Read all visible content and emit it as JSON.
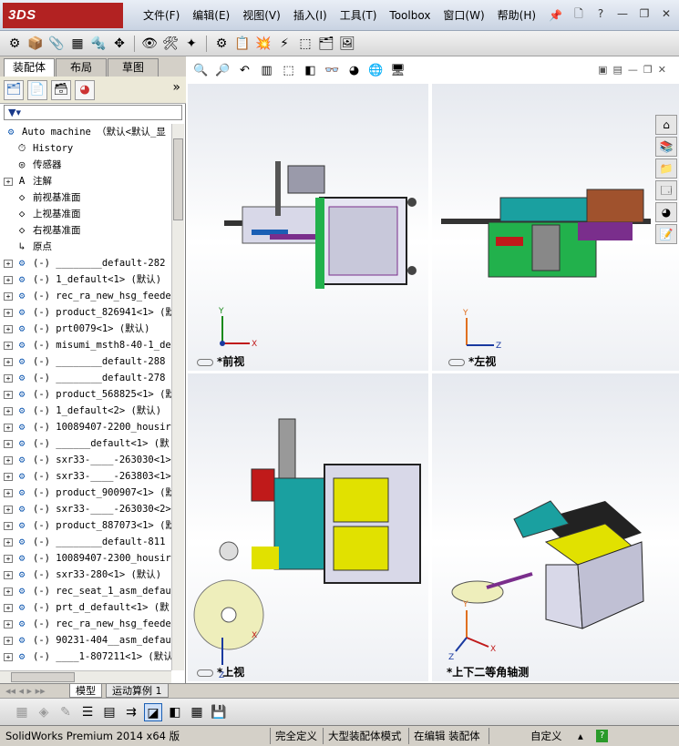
{
  "app": {
    "logo": "3DS SOLIDWORKS"
  },
  "menu": [
    "文件(F)",
    "编辑(E)",
    "视图(V)",
    "插入(I)",
    "工具(T)",
    "Toolbox",
    "窗口(W)",
    "帮助(H)"
  ],
  "panel": {
    "tabs": [
      "装配体",
      "布局",
      "草图"
    ],
    "filter_icon": "filter-icon"
  },
  "tree": {
    "root": "Auto machine （默认<默认_显",
    "items": [
      {
        "icon": "history",
        "label": "History",
        "expand": false
      },
      {
        "icon": "sensor",
        "label": "传感器",
        "expand": false
      },
      {
        "icon": "annotation",
        "label": "注解",
        "expand": true
      },
      {
        "icon": "plane",
        "label": "前视基准面",
        "expand": false
      },
      {
        "icon": "plane",
        "label": "上视基准面",
        "expand": false
      },
      {
        "icon": "plane",
        "label": "右视基准面",
        "expand": false
      },
      {
        "icon": "origin",
        "label": "原点",
        "expand": false
      },
      {
        "icon": "asm",
        "label": "(-) ________default-282",
        "expand": true
      },
      {
        "icon": "asm",
        "label": "(-) 1_default<1> (默认)",
        "expand": true
      },
      {
        "icon": "asm",
        "label": "(-) rec_ra_new_hsg_feede",
        "expand": true
      },
      {
        "icon": "asm",
        "label": "(-) product_826941<1> (默",
        "expand": true
      },
      {
        "icon": "asm",
        "label": "(-) prt0079<1> (默认)",
        "expand": true
      },
      {
        "icon": "asm",
        "label": "(-) misumi_msth8-40-1_de",
        "expand": true
      },
      {
        "icon": "asm",
        "label": "(-) ________default-288",
        "expand": true
      },
      {
        "icon": "asm",
        "label": "(-) ________default-278",
        "expand": true
      },
      {
        "icon": "asm",
        "label": "(-) product_568825<1> (默",
        "expand": true
      },
      {
        "icon": "asm",
        "label": "(-) 1_default<2> (默认)",
        "expand": true
      },
      {
        "icon": "asm",
        "label": "(-) 10089407-2200_housir",
        "expand": true
      },
      {
        "icon": "asm",
        "label": "(-) ______default<1> (默",
        "expand": true
      },
      {
        "icon": "asm",
        "label": "(-) sxr33-____-263030<1>",
        "expand": true
      },
      {
        "icon": "asm",
        "label": "(-) sxr33-____-263803<1>",
        "expand": true
      },
      {
        "icon": "asm",
        "label": "(-) product_900907<1> (默",
        "expand": true
      },
      {
        "icon": "asm",
        "label": "(-) sxr33-____-263030<2>",
        "expand": true
      },
      {
        "icon": "asm",
        "label": "(-) product_887073<1> (默",
        "expand": true
      },
      {
        "icon": "asm",
        "label": "(-) ________default-811",
        "expand": true
      },
      {
        "icon": "asm",
        "label": "(-) 10089407-2300_housir",
        "expand": true
      },
      {
        "icon": "asm",
        "label": "(-) sxr33-280<1> (默认)",
        "expand": true
      },
      {
        "icon": "asm",
        "label": "(-) rec_seat_1_asm_defau",
        "expand": true
      },
      {
        "icon": "asm",
        "label": "(-) prt_d_default<1> (默",
        "expand": true
      },
      {
        "icon": "asm",
        "label": "(-) rec_ra_new_hsg_feede",
        "expand": true
      },
      {
        "icon": "asm",
        "label": "(-) 90231-404__asm_defau",
        "expand": true
      },
      {
        "icon": "asm",
        "label": "(-) ____1-807211<1> (默认",
        "expand": true
      }
    ]
  },
  "viewports": [
    {
      "label": "*前视",
      "axes": [
        "Y",
        "X"
      ]
    },
    {
      "label": "*左视",
      "axes": [
        "Y",
        "Z"
      ]
    },
    {
      "label": "*上视",
      "axes": [
        "X",
        "Z"
      ]
    },
    {
      "label": "*上下二等角轴测",
      "axes": [
        "Y",
        "X",
        "Z"
      ]
    }
  ],
  "bottom_tabs": [
    "模型",
    "运动算例 1"
  ],
  "status": {
    "product": "SolidWorks Premium 2014 x64 版",
    "fully_defined": "完全定义",
    "large_asm": "大型装配体模式",
    "editing": "在编辑 装配体",
    "custom": "自定义"
  },
  "colors": {
    "logo_bg": "#b22222",
    "accent": "#1a5fb4",
    "green": "#22b14c",
    "yellow": "#e1e100",
    "teal": "#1aa0a0"
  }
}
